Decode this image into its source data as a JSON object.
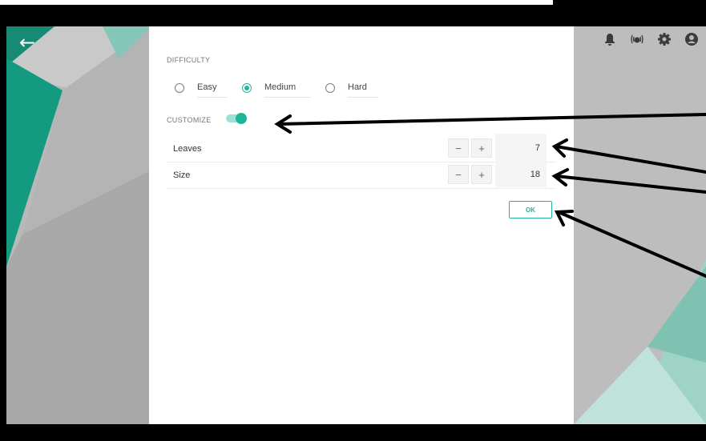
{
  "app": {
    "back_icon": "arrow-left-icon",
    "status_icons": [
      "bell-icon",
      "sensor-icon",
      "gear-icon",
      "account-icon"
    ]
  },
  "dialog": {
    "difficulty_label": "DIFFICULTY",
    "difficulty_options": [
      {
        "label": "Easy",
        "selected": false
      },
      {
        "label": "Medium",
        "selected": true
      },
      {
        "label": "Hard",
        "selected": false
      }
    ],
    "customize_label": "CUSTOMIZE",
    "customize_enabled": true,
    "params": [
      {
        "label": "Leaves",
        "minus": "−",
        "plus": "+",
        "value": "7"
      },
      {
        "label": "Size",
        "minus": "−",
        "plus": "+",
        "value": "18"
      }
    ],
    "ok_label": "OK"
  },
  "colors": {
    "accent": "#1fb59b",
    "accent_light": "#9be2d4",
    "background_teal": "#17866f",
    "background_grey": "#b9b9b9"
  }
}
